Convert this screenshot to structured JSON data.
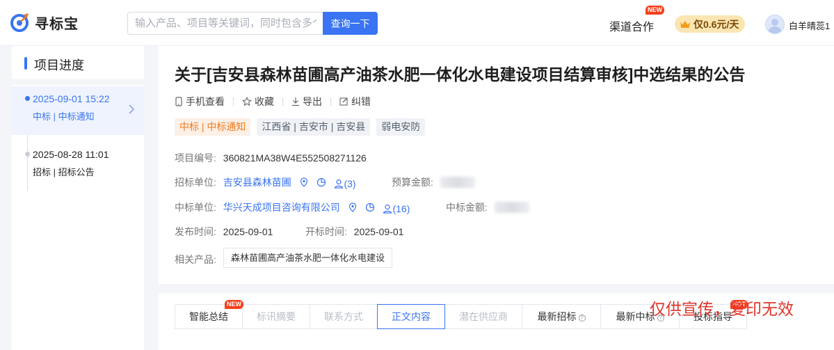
{
  "header": {
    "logo_text": "寻标宝",
    "search_placeholder": "输入产品、项目等关键词，同时包含多个关键词时用空格隔开",
    "search_button": "查询一下",
    "channel_label": "渠道合作",
    "new_badge": "NEW",
    "price_label": "仅0.6元/天",
    "username": "白羊晴蕊1"
  },
  "sidebar": {
    "title": "项目进度",
    "items": [
      {
        "date": "2025-09-01 15:22",
        "type": "中标 | 中标通知",
        "active": true
      },
      {
        "date": "2025-08-28 11:01",
        "type": "招标 | 招标公告",
        "active": false
      }
    ]
  },
  "notice": {
    "title": "关于[吉安县森林苗圃高产油茶水肥一体化水电建设项目结算审核]中选结果的公告",
    "actions": [
      "手机查看",
      "收藏",
      "导出",
      "纠错"
    ],
    "tags": [
      {
        "text": "中标 | 中标通知",
        "style": "orange"
      },
      {
        "text": "江西省 | 吉安市 | 吉安县",
        "style": "gray"
      },
      {
        "text": "弱电安防",
        "style": "gray"
      }
    ],
    "project_no_label": "项目编号:",
    "project_no": "360821MA38W4E552508271126",
    "tenderer_label": "招标单位:",
    "tenderer": "吉安县森林苗圃",
    "tenderer_contacts": "(3)",
    "budget_label": "预算金额:",
    "winner_label": "中标单位:",
    "winner": "华兴天成项目咨询有限公司",
    "winner_contacts": "(16)",
    "win_amount_label": "中标金额:",
    "publish_label": "发布时间:",
    "publish_date": "2025-09-01",
    "open_label": "开标时间:",
    "open_date": "2025-09-01",
    "product_label": "相关产品:",
    "product": "森林苗圃高产油茶水肥一体化水电建设"
  },
  "tabs": [
    {
      "label": "智能总结",
      "state": "normal",
      "badge": "NEW"
    },
    {
      "label": "标讯摘要",
      "state": "disabled"
    },
    {
      "label": "联系方式",
      "state": "disabled"
    },
    {
      "label": "正文内容",
      "state": "active"
    },
    {
      "label": "潜在供应商",
      "state": "disabled"
    },
    {
      "label": "最新招标",
      "state": "normal",
      "help": true
    },
    {
      "label": "最新中标",
      "state": "normal",
      "help": true
    },
    {
      "label": "投标指导",
      "state": "normal",
      "badge": "HOT"
    }
  ],
  "watermark": "仅供宣传，复印无效",
  "colors": {
    "accent": "#3a74f2",
    "orange": "#f07a1c",
    "badge": "#f5401b"
  }
}
